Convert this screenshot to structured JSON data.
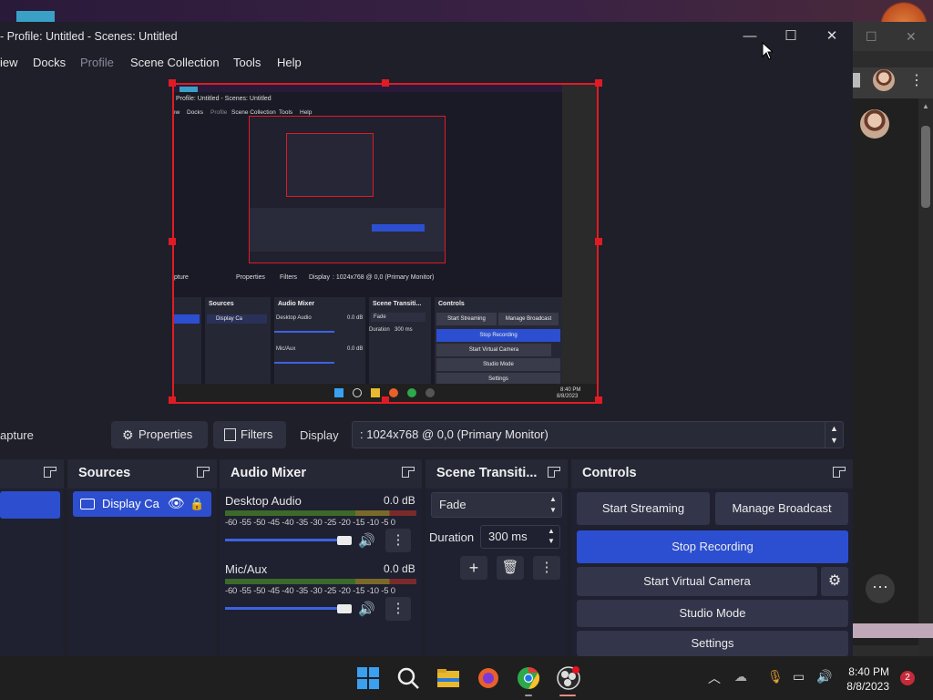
{
  "window": {
    "title": "- Profile: Untitled - Scenes: Untitled",
    "minimize_glyph": "—",
    "maximize_glyph": "☐",
    "close_glyph": "✕"
  },
  "menu": {
    "items": [
      {
        "label": "iew",
        "enabled": true
      },
      {
        "label": "Docks",
        "enabled": true
      },
      {
        "label": "Profile",
        "enabled": false
      },
      {
        "label": "Scene Collection",
        "enabled": true
      },
      {
        "label": "Tools",
        "enabled": true
      },
      {
        "label": "Help",
        "enabled": true
      }
    ]
  },
  "mini": {
    "title": "Profile: Untitled - Scenes: Untitled",
    "menu": [
      "ew",
      "Docks",
      "Profile",
      "Scene Collection",
      "Tools",
      "Help"
    ],
    "capture": "pture",
    "properties": "Properties",
    "filters": "Filters",
    "display_label": "Display",
    "display_value": ": 1024x768 @ 0,0 (Primary Monitor)",
    "sources": "Sources",
    "audio_mixer": "Audio Mixer",
    "scene_transitions": "Scene Transiti...",
    "controls": "Controls",
    "source_item": "Display Ca",
    "desktop_audio": "Desktop Audio",
    "mic_aux": "Mic/Aux",
    "db": "0.0 dB",
    "fade": "Fade",
    "duration": "Duration",
    "duration_value": "300 ms",
    "start_streaming": "Start Streaming",
    "manage_broadcast": "Manage Broadcast",
    "stop_recording": "Stop Recording",
    "start_virtual_camera": "Start Virtual Camera",
    "studio_mode": "Studio Mode",
    "settings": "Settings",
    "clock_time": "8:40 PM",
    "clock_date": "8/8/2023"
  },
  "toolbar": {
    "capture_label": "apture",
    "properties_label": "Properties",
    "filters_label": "Filters",
    "display_label": "Display",
    "display_value": ": 1024x768 @ 0,0 (Primary Monitor)"
  },
  "docks": {
    "scenes_title": "",
    "sources_title": "Sources",
    "source_item": "Display Ca",
    "mixer_title": "Audio Mixer",
    "mixer_channels": [
      {
        "name": "Desktop Audio",
        "db": "0.0 dB"
      },
      {
        "name": "Mic/Aux",
        "db": "0.0 dB"
      }
    ],
    "meter_ticks": "-60 -55 -50 -45 -40 -35 -30 -25 -20 -15 -10 -5  0",
    "transitions_title": "Scene Transiti...",
    "transition_value": "Fade",
    "duration_label": "Duration",
    "duration_value": "300 ms",
    "controls_title": "Controls",
    "start_streaming": "Start Streaming",
    "manage_broadcast": "Manage Broadcast",
    "stop_recording": "Stop Recording",
    "start_virtual_camera": "Start Virtual Camera",
    "studio_mode": "Studio Mode",
    "settings": "Settings"
  },
  "taskbar": {
    "time": "8:40 PM",
    "date": "8/8/2023",
    "notification_count": "2"
  },
  "colors": {
    "accent": "#2c4fd1",
    "selection": "#e01b24",
    "window_bg": "#1e1f29",
    "dock_bg": "#262836"
  }
}
